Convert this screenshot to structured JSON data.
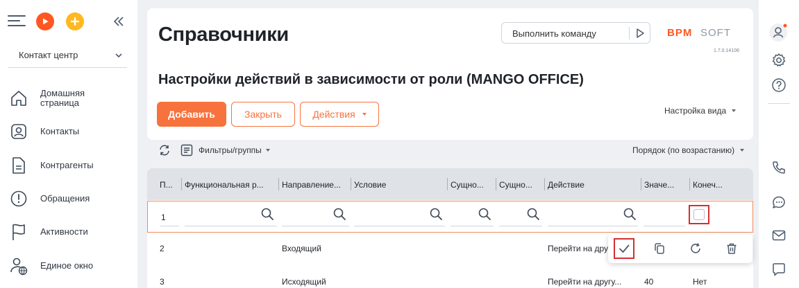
{
  "sidebar": {
    "workplace": "Контакт центр",
    "items": [
      {
        "label": "Домашняя страница",
        "icon": "home-icon"
      },
      {
        "label": "Контакты",
        "icon": "contact-icon"
      },
      {
        "label": "Контрагенты",
        "icon": "document-icon"
      },
      {
        "label": "Обращения",
        "icon": "alert-icon"
      },
      {
        "label": "Активности",
        "icon": "flag-icon"
      },
      {
        "label": "Единое окно",
        "icon": "user-globe-icon"
      }
    ]
  },
  "header": {
    "title": "Справочники",
    "command_placeholder": "Выполнить команду",
    "logo": "BPMSOFT",
    "version": "1.7.0.14106"
  },
  "section": {
    "title": "Настройки действий в зависимости от роли (MANGO OFFICE)",
    "add_label": "Добавить",
    "close_label": "Закрыть",
    "actions_label": "Действия",
    "view_settings": "Настройка вида"
  },
  "filters": {
    "filters_label": "Фильтры/группы",
    "sort_label": "Порядок (по возрастанию)"
  },
  "grid": {
    "columns": [
      "П...",
      "Функциональная р...",
      "Направление...",
      "Условие",
      "Сущно...",
      "Сущно...",
      "Действие",
      "Значе...",
      "Конеч..."
    ],
    "edit_row_number": "1",
    "rows": [
      {
        "num": "2",
        "direction": "Входящий",
        "action": "Перейти на другу..."
      },
      {
        "num": "3",
        "direction": "Исходящий",
        "action": "Перейти на другу...",
        "value": "40",
        "final": "Нет"
      }
    ]
  },
  "colors": {
    "accent": "#f7723c",
    "highlight": "#d32f2f"
  }
}
